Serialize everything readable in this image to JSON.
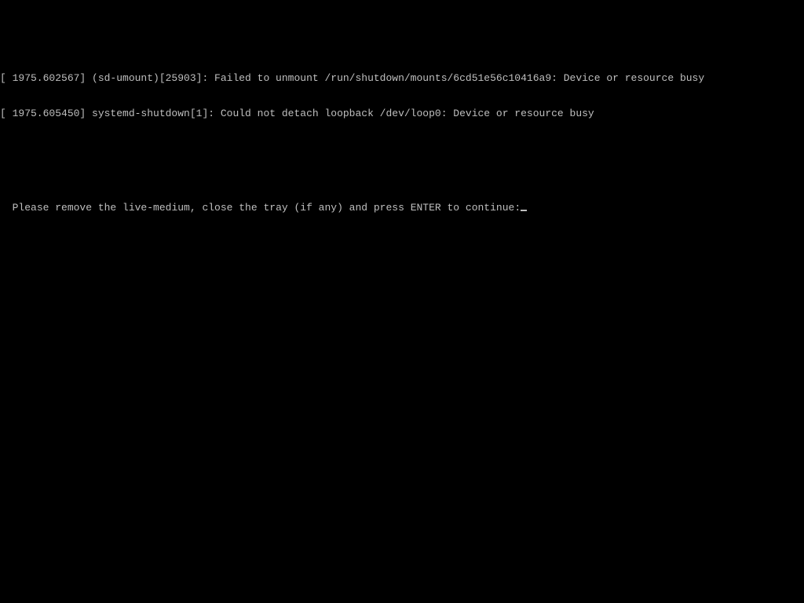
{
  "console": {
    "lines": [
      "[ 1975.602567] (sd-umount)[25903]: Failed to unmount /run/shutdown/mounts/6cd51e56c10416a9: Device or resource busy",
      "[ 1975.605450] systemd-shutdown[1]: Could not detach loopback /dev/loop0: Device or resource busy"
    ],
    "blank_lines": 2,
    "prompt": "Please remove the live-medium, close the tray (if any) and press ENTER to continue:"
  }
}
